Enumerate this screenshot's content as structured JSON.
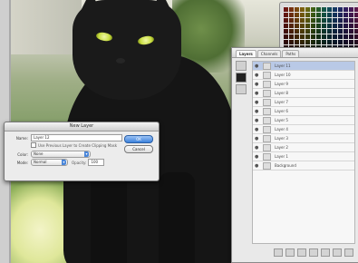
{
  "app": {
    "layers_panel": {
      "tabs": [
        {
          "label": "Layers"
        },
        {
          "label": "Channels"
        },
        {
          "label": "Paths"
        }
      ],
      "layers": [
        {
          "name": "Layer 11",
          "selected": true
        },
        {
          "name": "Layer 10"
        },
        {
          "name": "Layer 9"
        },
        {
          "name": "Layer 8"
        },
        {
          "name": "Layer 7"
        },
        {
          "name": "Layer 6"
        },
        {
          "name": "Layer 5"
        },
        {
          "name": "Layer 4"
        },
        {
          "name": "Layer 3"
        },
        {
          "name": "Layer 2"
        },
        {
          "name": "Layer 1"
        },
        {
          "name": "Background"
        }
      ],
      "footer_buttons": [
        "link-icon",
        "fx-icon",
        "mask-icon",
        "adjustment-icon",
        "folder-icon",
        "new-layer-icon",
        "trash-icon"
      ]
    },
    "dialog": {
      "title": "New Layer",
      "name_label": "Name:",
      "name_value": "Layer 12",
      "clip_checkbox_label": "Use Previous Layer to Create Clipping Mask",
      "color_label": "Color:",
      "color_value": "None",
      "mode_label": "Mode:",
      "mode_value": "Normal",
      "opacity_label": "Opacity:",
      "opacity_value": "100",
      "ok_label": "OK",
      "cancel_label": "Cancel"
    },
    "swatches": {
      "colors": [
        "#d21f2b",
        "#f07a1c",
        "#f4d21c",
        "#59b832",
        "#1fa9a3",
        "#2b63c8",
        "#6a35b6",
        "#c22f8f"
      ]
    }
  }
}
